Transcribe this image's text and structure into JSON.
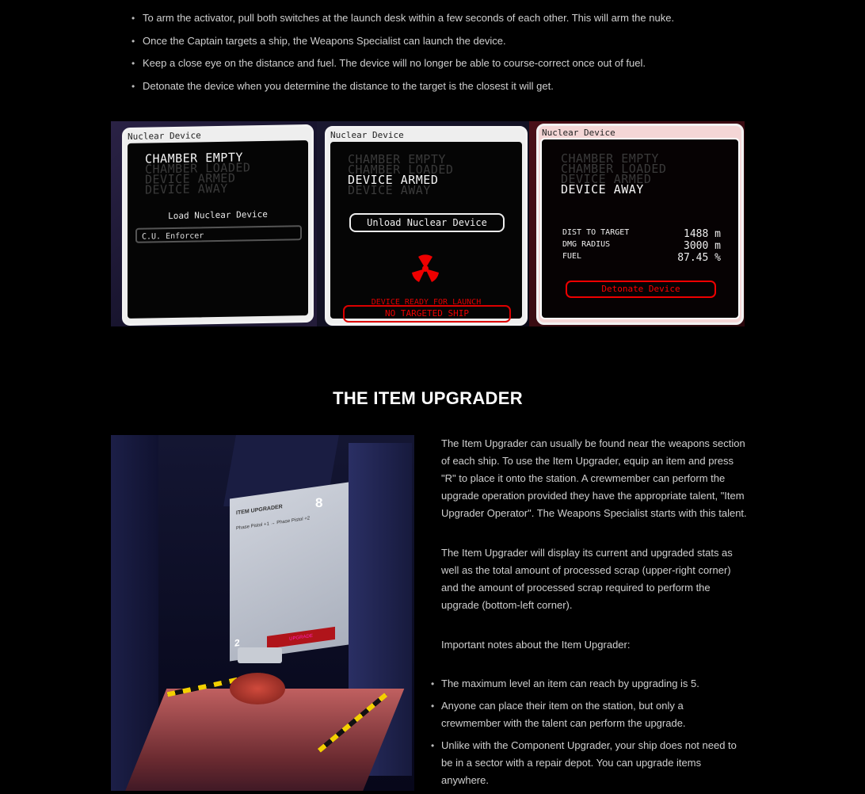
{
  "top_bullets": [
    "To arm the activator, pull both switches at the launch desk within a few seconds of each other. This will arm the nuke.",
    "Once the Captain targets a ship, the Weapons Specialist can launch the device.",
    "Keep a close eye on the distance and fuel. The device will no longer be able to course-correct once out of fuel.",
    "Detonate the device when you determine the distance to the target is the closest it will get."
  ],
  "screens": {
    "header": "Nuclear Device",
    "states": [
      "CHAMBER EMPTY",
      "CHAMBER LOADED",
      "DEVICE ARMED",
      "DEVICE AWAY"
    ],
    "screen1": {
      "load_label": "Load Nuclear Device",
      "field_value": "C.U. Enforcer"
    },
    "screen2": {
      "unload_button": "Unload Nuclear Device",
      "ready_text": "DEVICE READY FOR LAUNCH",
      "no_target": "NO TARGETED SHIP"
    },
    "screen3": {
      "stats": [
        {
          "label": "DIST TO TARGET",
          "value": "1488 m"
        },
        {
          "label": "DMG RADIUS",
          "value": "3000 m"
        },
        {
          "label": "FUEL",
          "value": "87.45 %"
        }
      ],
      "detonate_button": "Detonate Device"
    }
  },
  "section_title": "THE ITEM UPGRADER",
  "upgrader_image": {
    "panel_title": "ITEM UPGRADER",
    "panel_sub": "Phase Pistol +1  →  Phase Pistol +2",
    "upgrade_button": "UPGRADE",
    "cost": "2",
    "scrap": "8"
  },
  "paragraphs": [
    "The Item Upgrader can usually be found near the weapons section of each ship. To use the Item Upgrader, equip an item and press \"R\" to place it onto the station. A crewmember can perform the upgrade operation provided they have the appropriate talent, \"Item Upgrader Operator\". The Weapons Specialist starts with this talent.",
    "The Item Upgrader will display its current and upgraded stats as well as the total amount of processed scrap (upper-right corner) and the amount of processed scrap required to perform the upgrade (bottom-left corner).",
    "Important notes about the Item Upgrader:"
  ],
  "bottom_bullets": [
    "The maximum level an item can reach by upgrading is 5.",
    "Anyone can place their item on the station, but only a crewmember with the talent can perform the upgrade.",
    "Unlike with the Component Upgrader, your ship does not need to be in a sector with a repair depot. You can upgrade items anywhere."
  ],
  "bullet_glyph": "•"
}
